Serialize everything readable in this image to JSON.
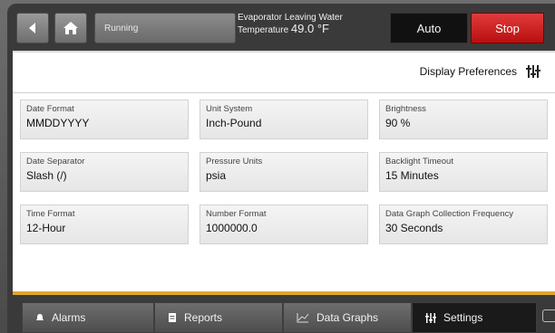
{
  "header": {
    "status": "Running",
    "evaporator_label": "Evaporator Leaving Water",
    "evaporator_prefix": "Temperature",
    "evaporator_value": "49.0 °F",
    "auto_label": "Auto",
    "stop_label": "Stop"
  },
  "page": {
    "title": "Display Preferences"
  },
  "settings": [
    {
      "label": "Date Format",
      "value": "MMDDYYYY"
    },
    {
      "label": "Unit System",
      "value": "Inch-Pound"
    },
    {
      "label": "Brightness",
      "value": "90 %"
    },
    {
      "label": "Date Separator",
      "value": "Slash (/)"
    },
    {
      "label": "Pressure Units",
      "value": "psia"
    },
    {
      "label": "Backlight Timeout",
      "value": "15 Minutes"
    },
    {
      "label": "Time Format",
      "value": "12-Hour"
    },
    {
      "label": "Number Format",
      "value": "1000000.0"
    },
    {
      "label": "Data Graph Collection Frequency",
      "value": "30 Seconds"
    }
  ],
  "tabs": [
    {
      "label": "Alarms",
      "icon": "bell-icon"
    },
    {
      "label": "Reports",
      "icon": "document-icon"
    },
    {
      "label": "Data Graphs",
      "icon": "chart-icon"
    },
    {
      "label": "Settings",
      "icon": "sliders-icon"
    }
  ],
  "colors": {
    "stop": "#d42020",
    "accent_line": "#e0a52a",
    "active_tab": "#1a1a1a"
  }
}
